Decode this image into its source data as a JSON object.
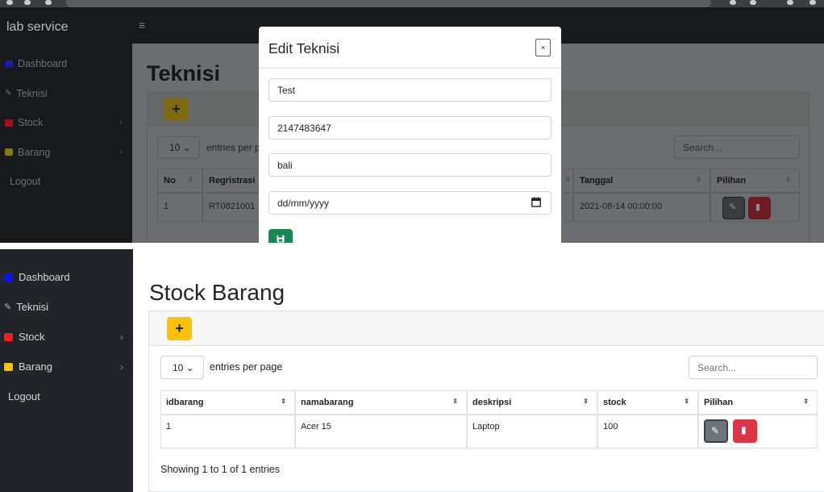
{
  "top_panel": {
    "app_brand": "lab service",
    "menu_toggle_icon": "hamburger-icon",
    "sidebar": {
      "items": [
        {
          "label": "Dashboard",
          "icon": "dashboard-icon",
          "icon_color": "#1a1aa8"
        },
        {
          "label": "Teknisi",
          "icon": "wrench-icon",
          "icon_color": "#6c7075"
        },
        {
          "label": "Stock",
          "icon": "database-icon",
          "icon_color": "#a3101a",
          "has_submenu": true
        },
        {
          "label": "Barang",
          "icon": "truck-icon",
          "icon_color": "#8a7a10",
          "has_submenu": true
        },
        {
          "label": "Logout",
          "icon": "",
          "icon_color": ""
        }
      ]
    },
    "page_title": "Teknisi",
    "add_label": "+",
    "entries_select": "10 ⌄",
    "entries_text": "entries per p",
    "search_placeholder": "Search...",
    "table": {
      "headers": [
        "No",
        "Regristrasi",
        "Tanggal",
        "Pilihan"
      ],
      "row": {
        "no": "1",
        "regristrasi": "RT0821001",
        "tanggal": "2021-08-14 00:00:00"
      }
    },
    "modal": {
      "title": "Edit Teknisi",
      "close_label": "×",
      "fields": {
        "name": "Test",
        "phone": "2147483647",
        "address": "bali",
        "date_placeholder": "dd/mm/yyyy"
      },
      "save_icon": "save-icon",
      "save_color": "#198754"
    }
  },
  "bottom_panel": {
    "sidebar": {
      "items": [
        {
          "label": "Dashboard",
          "icon": "dashboard-icon",
          "icon_color": "#0d0dff"
        },
        {
          "label": "Teknisi",
          "icon": "wrench-icon",
          "icon_color": "#adb5bd"
        },
        {
          "label": "Stock",
          "icon": "database-icon",
          "icon_color": "#ff1a1a",
          "has_submenu": true
        },
        {
          "label": "Barang",
          "icon": "truck-icon",
          "icon_color": "#ffc107",
          "has_submenu": true
        },
        {
          "label": "Logout",
          "icon": "",
          "icon_color": ""
        }
      ]
    },
    "page_title": "Stock Barang",
    "add_label": "+",
    "entries_select": "10 ⌄",
    "entries_text": "entries per page",
    "search_placeholder": "Search...",
    "table": {
      "headers": [
        "idbarang",
        "namabarang",
        "deskripsi",
        "stock",
        "Pilihan"
      ],
      "rows": [
        {
          "idbarang": "1",
          "namabarang": "Acer 15",
          "deskripsi": "Laptop",
          "stock": "100"
        }
      ]
    },
    "info_text": "Showing 1 to 1 of 1 entries",
    "edit_color": "#6c757d",
    "delete_color": "#dc3545"
  }
}
